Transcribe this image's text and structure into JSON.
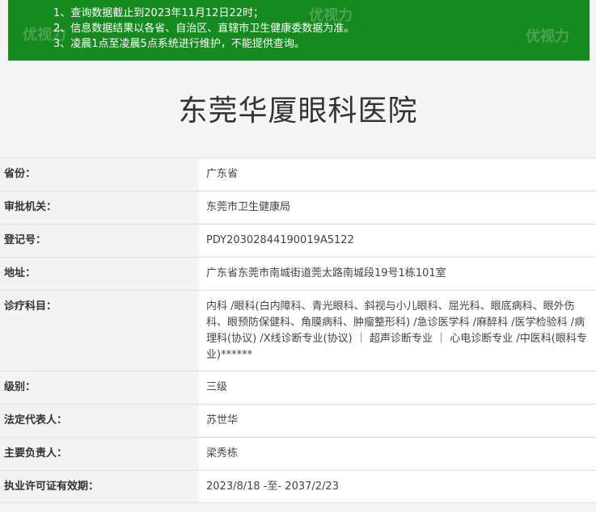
{
  "notice": {
    "lines": [
      "1、查询数据截止到2023年11月12日22时；",
      "2、信息数据结果以各省、自治区、直辖市卫生健康委数据为准。",
      "3、凌晨1点至凌晨5点系统进行维护，不能提供查询。"
    ],
    "watermark": "优视力"
  },
  "title": "东莞华厦眼科医院",
  "rows": [
    {
      "label": "省份：",
      "value": "广东省"
    },
    {
      "label": "审批机关：",
      "value": "东莞市卫生健康局"
    },
    {
      "label": "登记号：",
      "value": "PDY20302844190019A5122"
    },
    {
      "label": "地址：",
      "value": "广东省东莞市南城街道莞太路南城段19号1栋101室"
    },
    {
      "label": "诊疗科目：",
      "value": "内科 /眼科(白内障科、青光眼科、斜视与小儿眼科、屈光科、眼底病科、眼外伤科、眼预防保健科、角膜病科、肿瘤整形科) /急诊医学科 /麻醉科 /医学检验科 /病理科(协议) /X线诊断专业(协议) ｜ 超声诊断专业 ｜ 心电诊断专业 /中医科(眼科专业)******"
    },
    {
      "label": "级别：",
      "value": "三级"
    },
    {
      "label": "法定代表人：",
      "value": "苏世华"
    },
    {
      "label": "主要负责人：",
      "value": "梁秀栋"
    },
    {
      "label": "执业许可证有效期：",
      "value": "2023/8/18 -至- 2037/2/23"
    }
  ]
}
